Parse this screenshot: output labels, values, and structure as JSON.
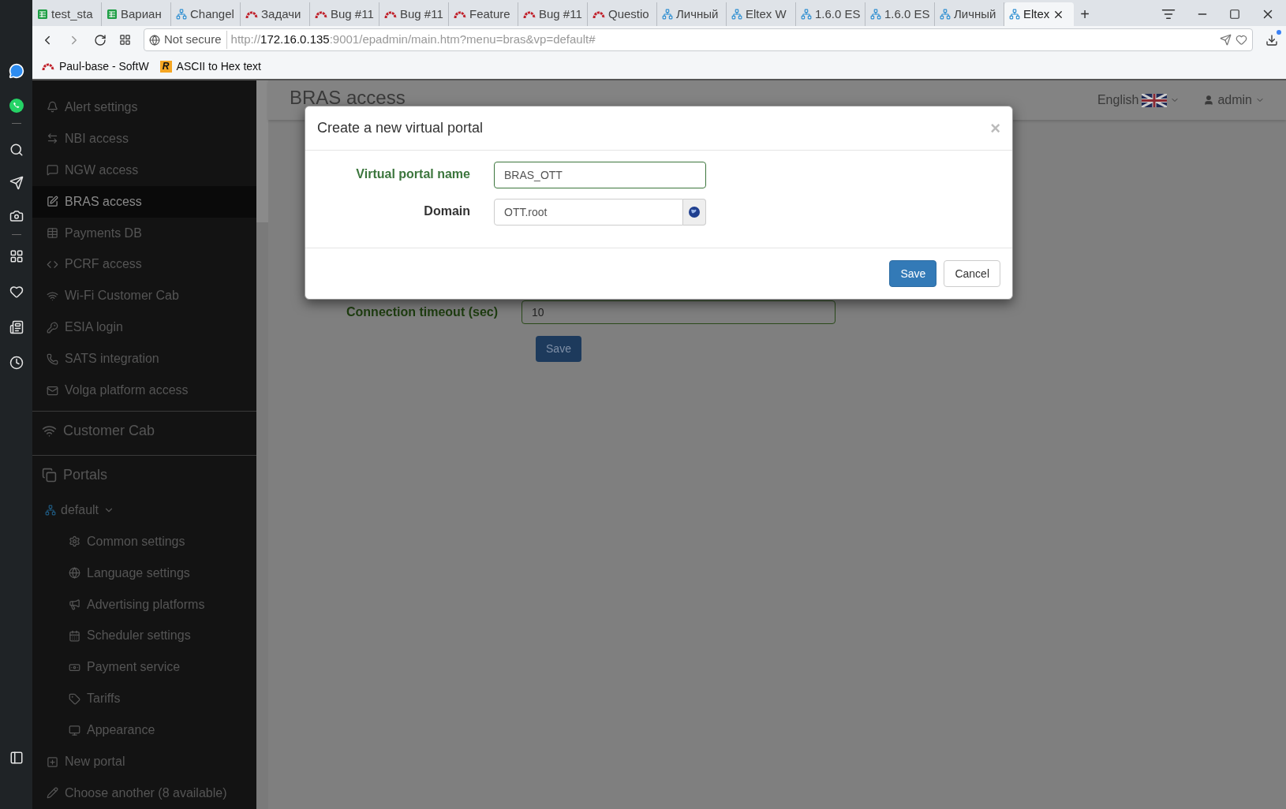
{
  "browser": {
    "tabs": [
      {
        "label": "test_sta",
        "kind": "sheet",
        "selected": false
      },
      {
        "label": "Вариан",
        "kind": "sheet",
        "selected": false
      },
      {
        "label": "Changel",
        "kind": "network",
        "selected": false
      },
      {
        "label": "Задачи",
        "kind": "redmine",
        "selected": false
      },
      {
        "label": "Bug #11",
        "kind": "redmine",
        "selected": false
      },
      {
        "label": "Bug #11",
        "kind": "redmine",
        "selected": false
      },
      {
        "label": "Feature",
        "kind": "redmine",
        "selected": false
      },
      {
        "label": "Bug #11",
        "kind": "redmine",
        "selected": false
      },
      {
        "label": "Questio",
        "kind": "redmine",
        "selected": false
      },
      {
        "label": "Личный",
        "kind": "network",
        "selected": false
      },
      {
        "label": "Eltex W",
        "kind": "network",
        "selected": false
      },
      {
        "label": "1.6.0 ES",
        "kind": "network",
        "selected": false
      },
      {
        "label": "1.6.0 ES",
        "kind": "network",
        "selected": false
      },
      {
        "label": "Личный",
        "kind": "network",
        "selected": false
      },
      {
        "label": "Eltex",
        "kind": "network",
        "selected": true
      }
    ],
    "new_tab": "+",
    "address": {
      "security": "Not secure",
      "url_scheme": "http://",
      "url_host": "172.16.0.135",
      "url_rest": ":9001/epadmin/main.htm?menu=bras&vp=default#"
    },
    "bookmarks": [
      {
        "label": "Paul-base - SoftW",
        "kind": "redmine"
      },
      {
        "label": "ASCII to Hex text",
        "kind": "letter",
        "badge": "R"
      }
    ]
  },
  "sidebar": {
    "items": [
      {
        "label": "Alert settings",
        "selected": false
      },
      {
        "label": "NBI access",
        "selected": false
      },
      {
        "label": "NGW access",
        "selected": false
      },
      {
        "label": "BRAS access",
        "selected": true
      },
      {
        "label": "Payments DB",
        "selected": false
      },
      {
        "label": "PCRF access",
        "selected": false
      },
      {
        "label": "Wi-Fi Customer Cab",
        "selected": false
      },
      {
        "label": "ESIA login",
        "selected": false
      },
      {
        "label": "SATS integration",
        "selected": false
      },
      {
        "label": "Volga platform access",
        "selected": false
      }
    ],
    "sections": [
      "Customer Cab",
      "Portals"
    ],
    "portal": {
      "label": "default",
      "expanded": true,
      "children": [
        {
          "label": "Common settings"
        },
        {
          "label": "Language settings"
        },
        {
          "label": "Advertising platforms"
        },
        {
          "label": "Scheduler settings"
        },
        {
          "label": "Payment service"
        },
        {
          "label": "Tariffs"
        },
        {
          "label": "Appearance"
        }
      ]
    },
    "actions": [
      "New portal",
      "Choose another (8 available)"
    ]
  },
  "header": {
    "title": "BRAS access",
    "language": "English",
    "user": "admin"
  },
  "form": {
    "label": "Connection timeout (sec)",
    "value": "10",
    "button": "Save"
  },
  "modal": {
    "title": "Create a new virtual portal",
    "close": "×",
    "fields": [
      {
        "label": "Virtual portal name",
        "value": "BRAS_OTT",
        "kind": "text",
        "valid": true
      },
      {
        "label": "Domain",
        "value": "OTT.root",
        "kind": "picker",
        "valid": false
      }
    ],
    "buttons": [
      {
        "label": "Save",
        "kind": "primary"
      },
      {
        "label": "Cancel",
        "kind": "default"
      }
    ]
  }
}
